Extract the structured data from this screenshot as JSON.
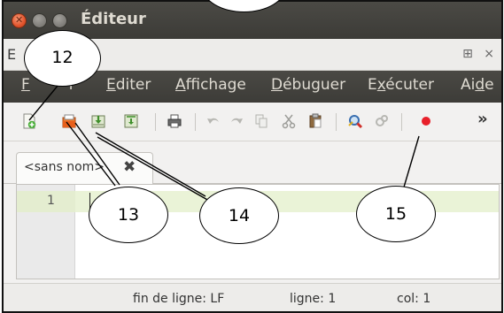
{
  "window": {
    "title": "Éditeur"
  },
  "panel": {
    "title": "E",
    "float_icon": "⊞",
    "close_icon": "×"
  },
  "menu": {
    "fichier": "F",
    "fichier_tail": "r",
    "editer_accel": "E",
    "editer_rest": "diter",
    "affichage_accel": "A",
    "affichage_rest": "ffichage",
    "debuguer_accel": "D",
    "debuguer_rest": "ébuguer",
    "executer_pre": "E",
    "executer_accel": "x",
    "executer_rest": "écuter",
    "aide_pre": "Ai",
    "aide_accel": "d",
    "aide_rest": "e"
  },
  "toolbar": {
    "icons": [
      "new-file-icon",
      "open-file-icon",
      "save-file-icon",
      "save-as-icon",
      "print-icon",
      "undo-icon",
      "redo-icon",
      "copy-icon",
      "cut-icon",
      "paste-icon",
      "find-icon",
      "replace-icon",
      "record-icon"
    ],
    "overflow": "»"
  },
  "tab": {
    "label": "<sans no",
    "label_tail": "m>",
    "close": "✖"
  },
  "editor": {
    "line_number": "1"
  },
  "status": {
    "line_ending": "fin de ligne: LF",
    "line": "ligne: 1",
    "col": "col: 1"
  },
  "callouts": {
    "c12": "12",
    "c13": "13",
    "c14": "14",
    "c15": "15"
  },
  "colors": {
    "record": "#e8202a",
    "titlebar": "#3c3b37",
    "current_line": "#eaf3d7"
  }
}
